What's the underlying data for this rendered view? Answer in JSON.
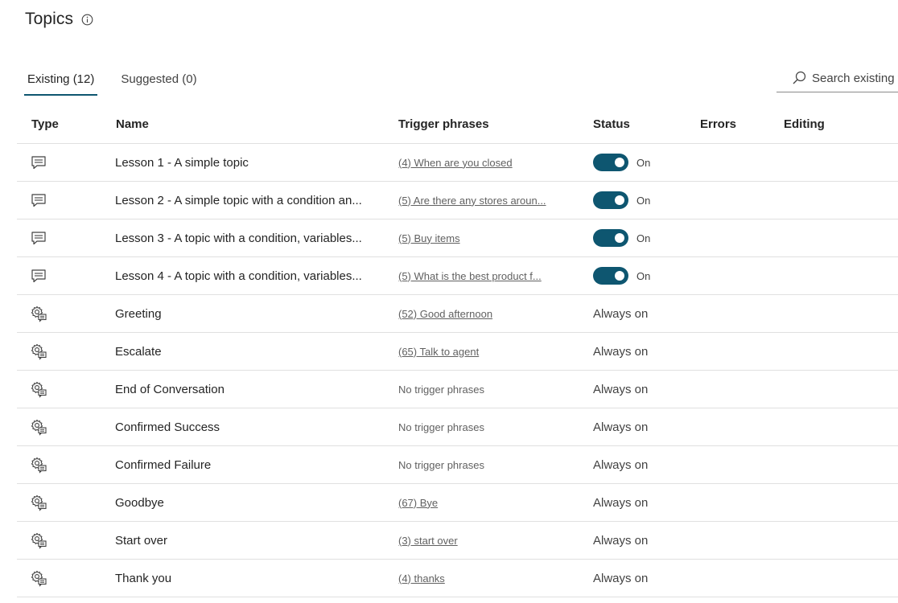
{
  "page": {
    "title": "Topics",
    "info_icon": "info-icon"
  },
  "tabs": [
    {
      "label": "Existing (12)",
      "active": true
    },
    {
      "label": "Suggested (0)",
      "active": false
    }
  ],
  "search": {
    "placeholder": "Search existing t",
    "icon": "search-icon"
  },
  "table": {
    "columns": [
      "Type",
      "Name",
      "Trigger phrases",
      "Status",
      "Errors",
      "Editing"
    ],
    "rows": [
      {
        "type_icon": "message-icon",
        "name": "Lesson 1 - A simple topic",
        "trigger": "(4) When are you closed",
        "status": "On",
        "toggle": true
      },
      {
        "type_icon": "message-icon",
        "name": "Lesson 2 - A simple topic with a condition an...",
        "trigger": "(5) Are there any stores aroun...",
        "status": "On",
        "toggle": true
      },
      {
        "type_icon": "message-icon",
        "name": "Lesson 3 - A topic with a condition, variables...",
        "trigger": "(5) Buy items",
        "status": "On",
        "toggle": true
      },
      {
        "type_icon": "message-icon",
        "name": "Lesson 4 - A topic with a condition, variables...",
        "trigger": "(5) What is the best product f...",
        "status": "On",
        "toggle": true
      },
      {
        "type_icon": "system-topic-icon",
        "name": "Greeting",
        "trigger": "(52) Good afternoon",
        "status": "Always on",
        "toggle": false
      },
      {
        "type_icon": "system-topic-icon",
        "name": "Escalate",
        "trigger": "(65) Talk to agent",
        "status": "Always on",
        "toggle": false
      },
      {
        "type_icon": "system-topic-icon",
        "name": "End of Conversation",
        "trigger": "No trigger phrases",
        "status": "Always on",
        "toggle": false
      },
      {
        "type_icon": "system-topic-icon",
        "name": "Confirmed Success",
        "trigger": "No trigger phrases",
        "status": "Always on",
        "toggle": false
      },
      {
        "type_icon": "system-topic-icon",
        "name": "Confirmed Failure",
        "trigger": "No trigger phrases",
        "status": "Always on",
        "toggle": false
      },
      {
        "type_icon": "system-topic-icon",
        "name": "Goodbye",
        "trigger": "(67) Bye",
        "status": "Always on",
        "toggle": false
      },
      {
        "type_icon": "system-topic-icon",
        "name": "Start over",
        "trigger": "(3) start over",
        "status": "Always on",
        "toggle": false
      },
      {
        "type_icon": "system-topic-icon",
        "name": "Thank you",
        "trigger": "(4) thanks",
        "status": "Always on",
        "toggle": false
      }
    ]
  },
  "colors": {
    "accent": "#0e5670",
    "divider": "#e0e0e0"
  }
}
